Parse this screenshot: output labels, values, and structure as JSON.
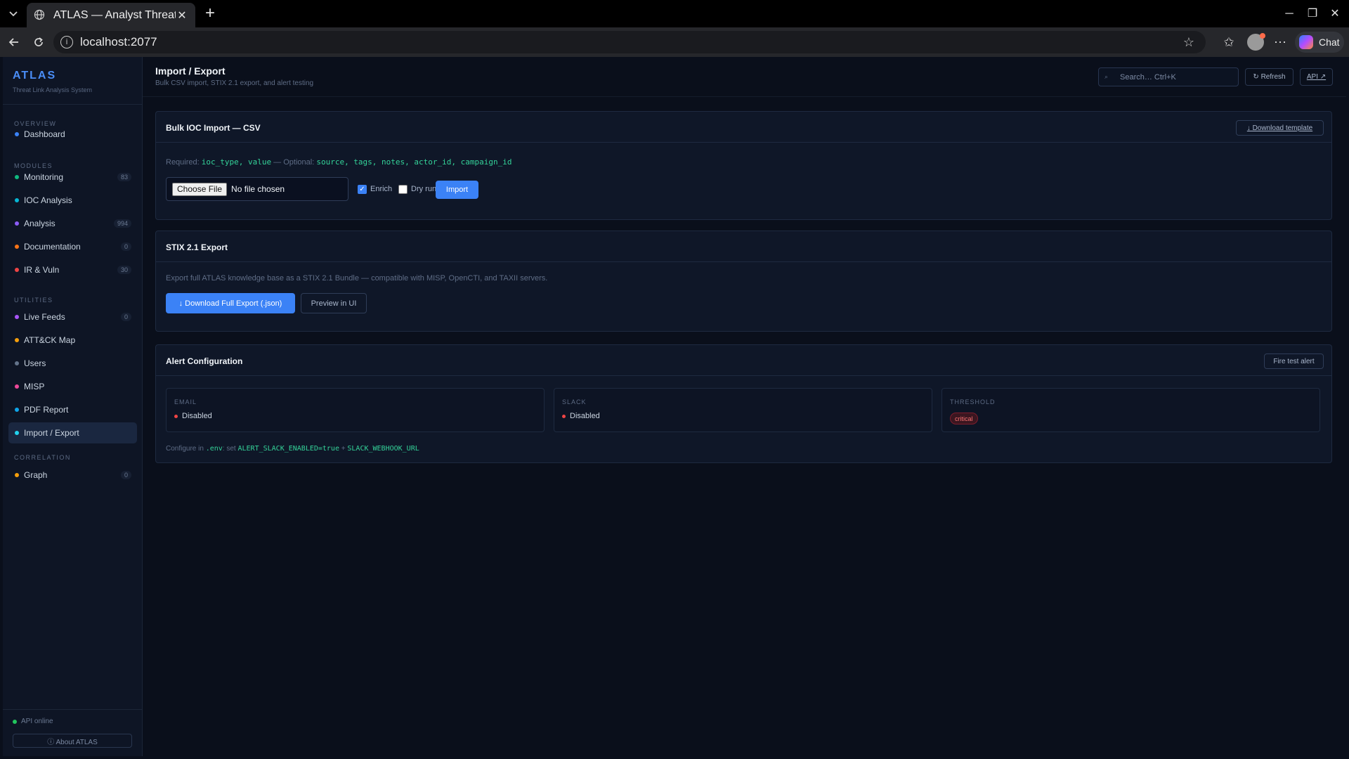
{
  "browser": {
    "tab_title": "ATLAS — Analyst Threat & I",
    "url": "localhost:2077",
    "chat_label": "Chat"
  },
  "sidebar": {
    "brand": "ATLAS",
    "brand_sub": "Threat Link Analysis System",
    "sections": {
      "overview": "OVERVIEW",
      "modules": "MODULES",
      "utilities": "UTILITIES",
      "correlation": "CORRELATION"
    },
    "items": [
      {
        "label": "Dashboard",
        "badge": "",
        "color": "#3b82f6"
      },
      {
        "label": "Monitoring",
        "badge": "83",
        "color": "#10b981"
      },
      {
        "label": "IOC Analysis",
        "badge": "",
        "color": "#06b6d4"
      },
      {
        "label": "Analysis",
        "badge": "994",
        "color": "#8b5cf6"
      },
      {
        "label": "Documentation",
        "badge": "0",
        "color": "#f97316"
      },
      {
        "label": "IR & Vuln",
        "badge": "30",
        "color": "#ef4444"
      },
      {
        "label": "Live Feeds",
        "badge": "0",
        "color": "#a855f7"
      },
      {
        "label": "ATT&CK Map",
        "badge": "",
        "color": "#f59e0b"
      },
      {
        "label": "Users",
        "badge": "",
        "color": "#64748b"
      },
      {
        "label": "MISP",
        "badge": "",
        "color": "#ec4899"
      },
      {
        "label": "PDF Report",
        "badge": "",
        "color": "#0ea5e9"
      },
      {
        "label": "Import / Export",
        "badge": "",
        "color": "#22d3ee"
      },
      {
        "label": "Graph",
        "badge": "0",
        "color": "#f59e0b"
      }
    ],
    "api_status": "API online",
    "about": "ⓘ About ATLAS"
  },
  "header": {
    "title": "Import / Export",
    "subtitle": "Bulk CSV import, STIX 2.1 export, and alert testing",
    "search_placeholder": "Search… Ctrl+K",
    "refresh": "↻ Refresh",
    "api": "API ↗"
  },
  "csv": {
    "title": "Bulk IOC Import — CSV",
    "download_template": "↓ Download template",
    "required_label": "Required:",
    "required_fields": "ioc_type, value",
    "optional_label": "— Optional:",
    "optional_fields": "source, tags, notes, actor_id, campaign_id",
    "choose_file": "Choose File",
    "no_file": "No file chosen",
    "enrich": "Enrich",
    "enrich_checked": true,
    "dry_run": "Dry run",
    "dry_run_checked": false,
    "import": "Import"
  },
  "stix": {
    "title": "STIX 2.1 Export",
    "description": "Export full ATLAS knowledge base as a STIX 2.1 Bundle — compatible with MISP, OpenCTI, and TAXII servers.",
    "download": "↓ Download Full Export (.json)",
    "preview": "Preview in UI"
  },
  "alerts": {
    "title": "Alert Configuration",
    "fire_test": "Fire test alert",
    "email_label": "EMAIL",
    "email_value": "Disabled",
    "slack_label": "SLACK",
    "slack_value": "Disabled",
    "threshold_label": "THRESHOLD",
    "threshold_value": "critical",
    "config_prefix": "Configure in",
    "config_file": ".env",
    "config_set": ": set",
    "config_var1": "ALERT_SLACK_ENABLED=true",
    "config_plus": "+",
    "config_var2": "SLACK_WEBHOOK_URL"
  }
}
